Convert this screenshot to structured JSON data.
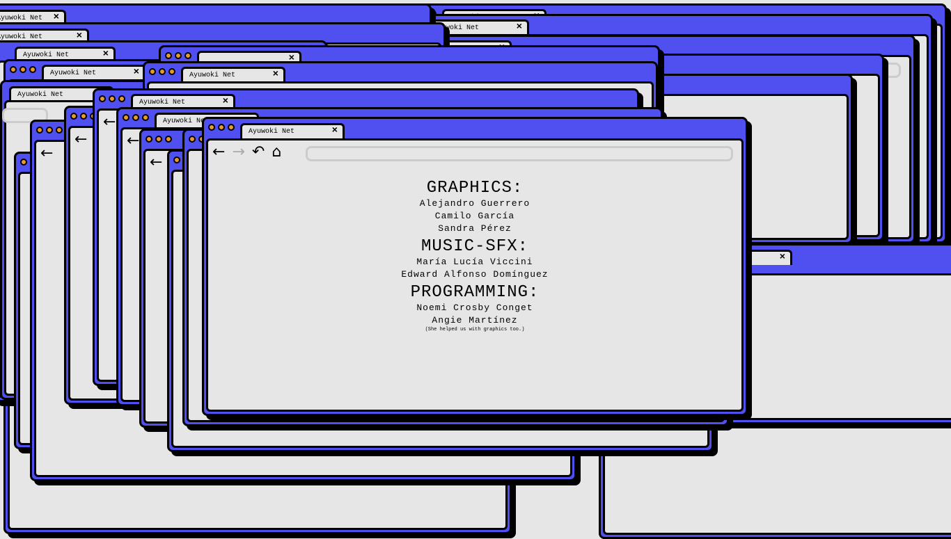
{
  "app": {
    "tab_title": "Ayuwoki Net",
    "accent": "#5050f0",
    "dot_color": "#e89a2e"
  },
  "nav": {
    "back": "←",
    "forward": "→",
    "undo": "↶",
    "home": "⌂"
  },
  "credits": {
    "graphics_heading": "GRAPHICS:",
    "graphics": [
      "Alejandro Guerrero",
      "Camilo García",
      "Sandra Pérez"
    ],
    "music_heading": "MUSIC-SFX:",
    "music": [
      "María Lucía Viccini",
      "Edward Alfonso Domínguez"
    ],
    "programming_heading": "PROGRAMMING:",
    "programming": [
      "Noemi Crosby Conget",
      "Angie Martínez"
    ],
    "note": "(She helped us with graphics too.)"
  }
}
